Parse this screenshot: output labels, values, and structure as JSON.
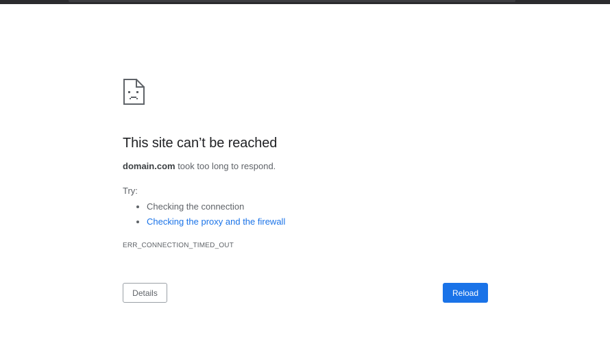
{
  "error_page": {
    "icon": "sad-page-icon",
    "title": "This site can’t be reached",
    "domain": "domain.com",
    "summary_suffix": " took too long to respond.",
    "try_label": "Try:",
    "suggestions": [
      {
        "text": "Checking the connection",
        "is_link": false
      },
      {
        "text": "Checking the proxy and the firewall",
        "is_link": true
      }
    ],
    "error_code": "ERR_CONNECTION_TIMED_OUT",
    "details_label": "Details",
    "reload_label": "Reload"
  },
  "colors": {
    "link": "#1a73e8",
    "primary_button": "#1a73e8",
    "title_text": "#202124",
    "body_text": "#5f6368"
  }
}
